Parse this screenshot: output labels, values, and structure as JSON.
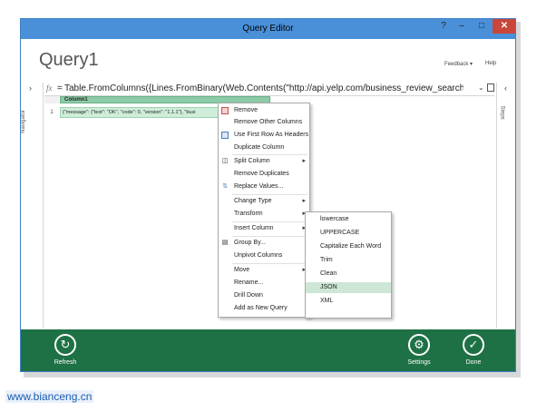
{
  "window": {
    "title": "Query Editor"
  },
  "query": {
    "name": "Query1"
  },
  "header": {
    "feedback": "Feedback ▾",
    "help": "Help"
  },
  "sidebar": {
    "left_label": "Navigator",
    "right_label": "Steps"
  },
  "formula": {
    "fx": "fx",
    "eq": "=",
    "text": "Table.FromColumns({Lines.FromBinary(Web.Contents(\"http://api.yelp.com/business_review_search?"
  },
  "table": {
    "column_header": "Column1",
    "rows": [
      {
        "num": "1",
        "value": "{\"message\": {\"text\": \"OK\", \"code\": 0, \"version\": \"1.1.1\"}, \"busi"
      }
    ]
  },
  "context_menu": {
    "items": [
      {
        "label": "Remove",
        "icon": "remove-column-icon"
      },
      {
        "label": "Remove Other Columns"
      },
      {
        "label": "Use First Row As Headers",
        "icon": "headers-icon"
      },
      {
        "label": "Duplicate Column"
      },
      {
        "label": "Split Column",
        "icon": "split-icon",
        "submenu": true
      },
      {
        "label": "Remove Duplicates"
      },
      {
        "label": "Replace Values...",
        "icon": "replace-icon"
      },
      {
        "label": "Change Type",
        "submenu": true
      },
      {
        "label": "Transform",
        "submenu": true
      },
      {
        "label": "Insert Column",
        "submenu": true
      },
      {
        "label": "Group By...",
        "icon": "group-icon"
      },
      {
        "label": "Unpivot Columns"
      },
      {
        "label": "Move",
        "submenu": true
      },
      {
        "label": "Rename..."
      },
      {
        "label": "Drill Down"
      },
      {
        "label": "Add as New Query"
      }
    ]
  },
  "transform_submenu": {
    "items": [
      "lowercase",
      "UPPERCASE",
      "Capitalize Each Word",
      "Trim",
      "Clean",
      "JSON",
      "XML"
    ],
    "selected": "JSON"
  },
  "footer": {
    "refresh": "Refresh",
    "settings": "Settings",
    "done": "Done"
  },
  "watermark": "www.bianceng.cn",
  "colors": {
    "titlebar": "#4a90d9",
    "footer": "#1e7145",
    "column_header": "#8ccba7",
    "cell": "#cfeed9",
    "close": "#c8463a"
  }
}
